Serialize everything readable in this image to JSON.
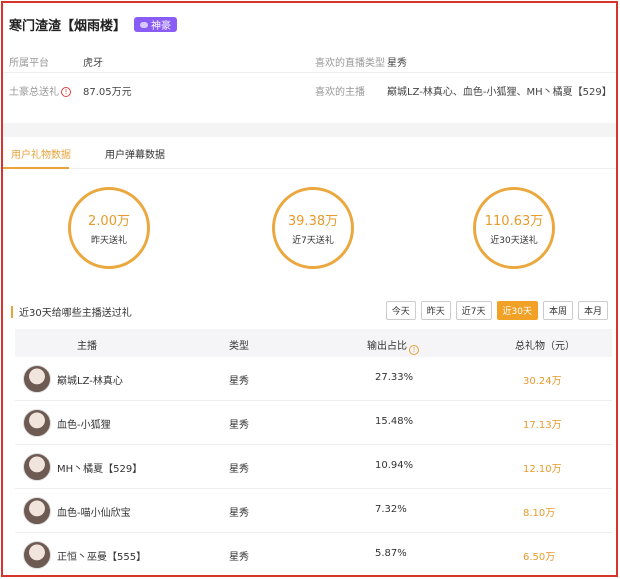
{
  "profile": {
    "name": "寒门渣渣【烟雨楼】",
    "badge": "神豪",
    "platform_label": "所属平台",
    "platform_value": "虎牙",
    "total_gift_label": "土豪总送礼",
    "total_gift_value": "87.05万元",
    "fav_type_label": "喜欢的直播类型",
    "fav_type_value": "星秀",
    "fav_hosts_label": "喜欢的主播",
    "fav_hosts_value": "巅城LZ-林真心、血色-小狐狸、MH丶橘夏【529】"
  },
  "tabs": [
    "用户礼物数据",
    "用户弹幕数据"
  ],
  "stats": [
    {
      "value": "2.00万",
      "caption": "昨天送礼"
    },
    {
      "value": "39.38万",
      "caption": "近7天送礼"
    },
    {
      "value": "110.63万",
      "caption": "近30天送礼"
    }
  ],
  "section": {
    "title": "近30天给哪些主播送过礼",
    "periods": [
      "今天",
      "昨天",
      "近7天",
      "近30天",
      "本周",
      "本月"
    ],
    "active_period": "近30天"
  },
  "table": {
    "headers": [
      "主播",
      "类型",
      "输出占比",
      "总礼物（元）"
    ],
    "rows": [
      {
        "host": "巅城LZ-林真心",
        "type": "星秀",
        "ratio": "27.33%",
        "gift": "30.24万"
      },
      {
        "host": "血色-小狐狸",
        "type": "星秀",
        "ratio": "15.48%",
        "gift": "17.13万"
      },
      {
        "host": "MH丶橘夏【529】",
        "type": "星秀",
        "ratio": "10.94%",
        "gift": "12.10万"
      },
      {
        "host": "血色-喵小仙欣宝",
        "type": "星秀",
        "ratio": "7.32%",
        "gift": "8.10万"
      },
      {
        "host": "正恒丶巫曼【555】",
        "type": "星秀",
        "ratio": "5.87%",
        "gift": "6.50万"
      }
    ]
  },
  "colors": {
    "accent": "#f0a126",
    "badge": "#8a5cf6",
    "frame": "#d8342e"
  }
}
